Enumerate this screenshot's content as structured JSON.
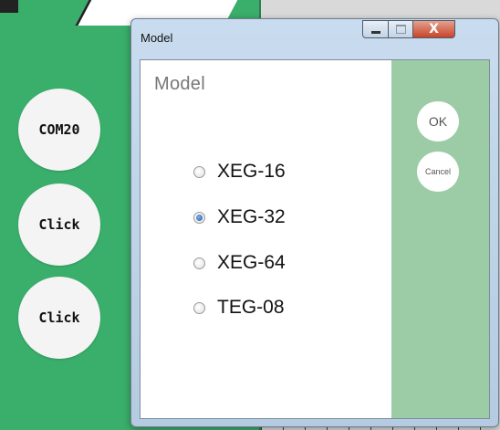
{
  "background": {
    "side_buttons": [
      {
        "label": "COM20"
      },
      {
        "label": "Click"
      },
      {
        "label": "Click"
      }
    ]
  },
  "dialog": {
    "title": "Model",
    "heading": "Model",
    "options": [
      {
        "label": "XEG-16",
        "checked": false
      },
      {
        "label": "XEG-32",
        "checked": true
      },
      {
        "label": "XEG-64",
        "checked": false
      },
      {
        "label": "TEG-08",
        "checked": false
      }
    ],
    "ok_label": "OK",
    "cancel_label": "Cancel",
    "close_glyph": "X"
  },
  "colors": {
    "background_green": "#3aae6b",
    "panel_green": "#9ccca6",
    "radio_checked": "#1d5aa8"
  }
}
